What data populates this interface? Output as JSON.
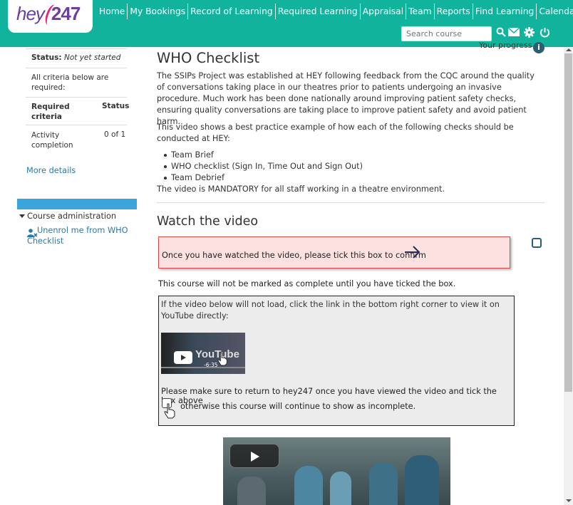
{
  "brand": {
    "logo_hey": "hey",
    "logo_num": "247"
  },
  "nav": [
    "Home",
    "My Bookings",
    "Record of Learning",
    "Required Learning",
    "Appraisal",
    "Team",
    "Reports",
    "Find Learning",
    "Calendar"
  ],
  "search": {
    "placeholder": "Search course"
  },
  "progress_label": "Your progress",
  "sidebar": {
    "status_label": "Status:",
    "status_value": "Not yet started",
    "criteria_note": "All criteria below are required:",
    "col_criteria": "Required criteria",
    "col_status": "Status",
    "row_name": "Activity completion",
    "row_value": "0 of 1",
    "more_details": "More details",
    "course_admin": "Course administration",
    "unenrol": "Unenrol me from WHO Checklist"
  },
  "main": {
    "title": "WHO Checklist",
    "para1": "The SSIPs Project was established at HEY following feedback from the CQC around the quality of conversations taking place in our theatres prior to patients undergoing an invasive procedure. Much work has been done nationally around improving patient safety checks, ensuring quality conversations are taking place to improve patient safety and avoid patient harm.",
    "para2": "This video shows a best practice example of how each of the following checks should be conducted at HEY:",
    "bullets": [
      "Team Brief",
      "WHO checklist (Sign In, Time Out and Sign Out)",
      "Team Debrief"
    ],
    "mandatory": "The video is MANDATORY for all staff working in a theatre environment.",
    "watch_title": "Watch the video",
    "confirm_text": "Once you have watched the video, please tick this box to confirm",
    "not_complete": "This course will not be marked as complete until you have ticked the box.",
    "grey_intro": "If the video below will not load, click the link in the bottom right corner to view it on YouTube directly:",
    "yt_time": "-6:35",
    "return_text1": "Please make sure to return to hey247 once you have viewed the video and tick the box above",
    "return_text2": "otherwise this course will continue to show as incomplete."
  },
  "colors": {
    "header": "#12b39c",
    "accent": "#3aa5d8",
    "pink": "#fde0e0",
    "brand_purple": "#6a3fa0"
  }
}
